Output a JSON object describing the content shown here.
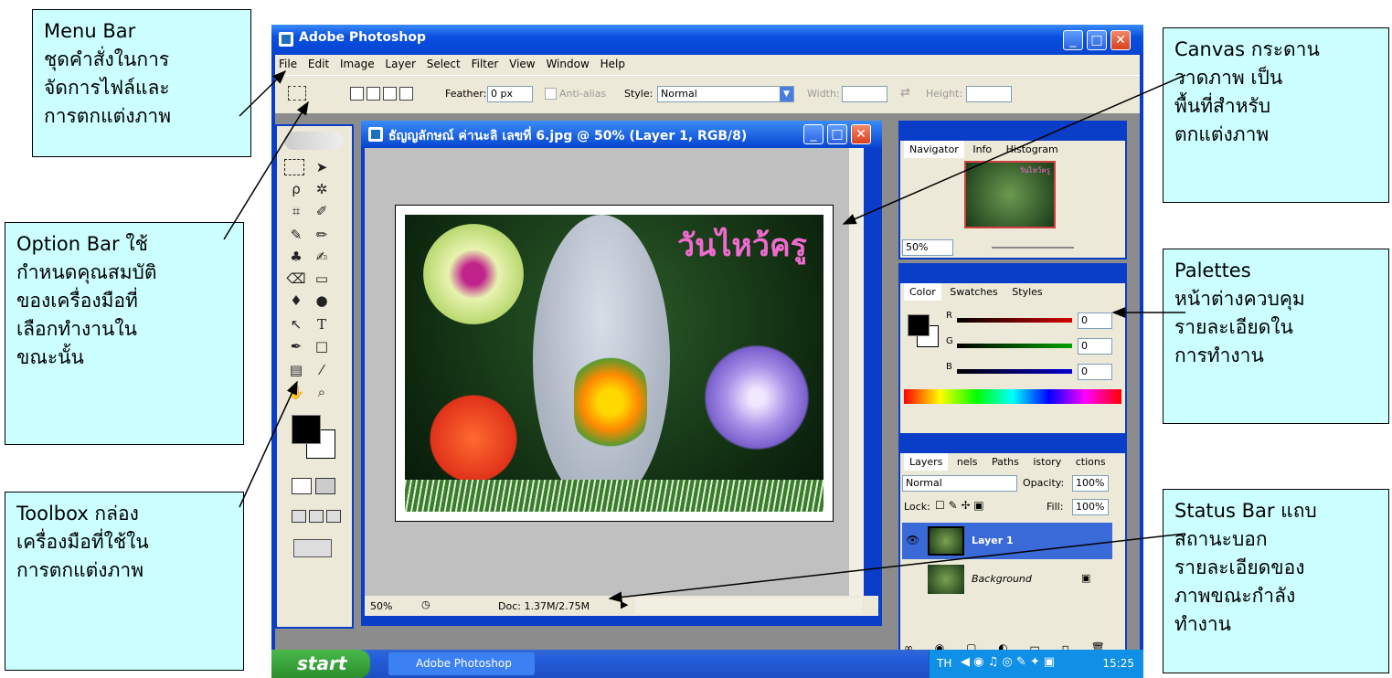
{
  "app": {
    "title": "Adobe Photoshop",
    "menu": [
      "File",
      "Edit",
      "Image",
      "Layer",
      "Select",
      "Filter",
      "View",
      "Window",
      "Help"
    ],
    "options": {
      "feather_label": "Feather:",
      "feather_value": "0 px",
      "antialias_label": "Anti-alias",
      "style_label": "Style:",
      "style_value": "Normal",
      "width_label": "Width:",
      "height_label": "Height:"
    },
    "document": {
      "title": "ธัญญลักษณ์ ค่านะลิ เลขที่ 6.jpg @ 50% (Layer 1, RGB/8)",
      "photo_text": "วันไหว้ครู",
      "zoom": "50%",
      "doc_size": "Doc: 1.37M/2.75M"
    },
    "navigator": {
      "tabs": [
        "Navigator",
        "Info",
        "Histogram"
      ],
      "zoom": "50%",
      "thumb_text": "วันไหว้ครู"
    },
    "color": {
      "tabs": [
        "Color",
        "Swatches",
        "Styles"
      ],
      "channels": [
        {
          "label": "R",
          "value": "0",
          "color": "#d40000"
        },
        {
          "label": "G",
          "value": "0",
          "color": "#00a000"
        },
        {
          "label": "B",
          "value": "0",
          "color": "#0000d0"
        }
      ]
    },
    "layers": {
      "tabs": [
        "Layers",
        "nels",
        "Paths",
        "istory",
        "ctions"
      ],
      "blend": "Normal",
      "opacity_label": "Opacity:",
      "opacity": "100%",
      "lock_label": "Lock:",
      "fill_label": "Fill:",
      "fill": "100%",
      "items": [
        "Layer 1",
        "Background"
      ]
    },
    "taskbar": {
      "start": "start",
      "task": "Adobe Photoshop",
      "lang": "TH",
      "clock": "15:25"
    }
  },
  "callouts": {
    "menu_bar": "Menu Bar\nชุดคำสั่งในการ\nจัดการไฟล์และ\nการตกแต่งภาพ",
    "option_bar": "Option Bar ใช้\nกำหนดคุณสมบัติ\nของเครื่องมือที่\nเลือกทำงานใน\nขณะนั้น",
    "toolbox": "Toolbox กล่อง\nเครื่องมือที่ใช้ใน\nการตกแต่งภาพ",
    "canvas": "Canvas กระดาน\nวาดภาพ เป็น\nพื้นที่สำหรับ\nตกแต่งภาพ",
    "palettes": "Palettes\nหน้าต่างควบคุม\nรายละเอียดใน\nการทำงาน",
    "status_bar": "Status Bar แถบ\nสถานะบอก\nรายละเอียดของ\nภาพขณะกำลัง\nทำงาน"
  }
}
